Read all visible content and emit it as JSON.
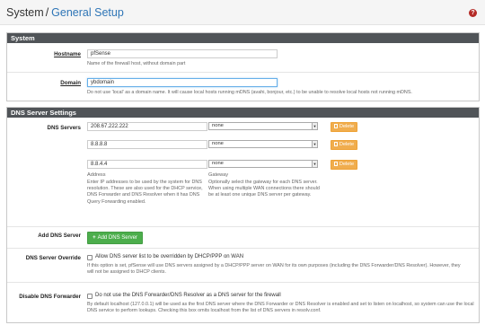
{
  "header": {
    "system": "System",
    "separator": "/",
    "current": "General Setup",
    "help": "?"
  },
  "system_panel": {
    "title": "System",
    "hostname": {
      "label": "Hostname",
      "value": "pfSense",
      "help": "Name of the firewall host, without domain part"
    },
    "domain": {
      "label": "Domain",
      "value": "ybdomain",
      "help": "Do not use 'local' as a domain name. It will cause local hosts running mDNS (avahi, bonjour, etc.) to be unable to resolve local hosts not running mDNS."
    }
  },
  "dns_panel": {
    "title": "DNS Server Settings",
    "servers_label": "DNS Servers",
    "servers": [
      {
        "address": "208.67.222.222",
        "gateway": "none",
        "delete": "Delete"
      },
      {
        "address": "8.8.8.8",
        "gateway": "none",
        "delete": "Delete"
      },
      {
        "address": "8.8.4.4",
        "gateway": "none",
        "delete": "Delete"
      }
    ],
    "address_sub": "Address",
    "address_help": "Enter IP addresses to be used by the system for DNS resolution. These are also used for the DHCP service, DNS Forwarder and DNS Resolver when it has DNS Query Forwarding enabled.",
    "gateway_sub": "Gateway",
    "gateway_help": "Optionally select the gateway for each DNS server. When using multiple WAN connections there should be at least one unique DNS server per gateway.",
    "add_label": "Add DNS Server",
    "add_button": "Add DNS Server",
    "override": {
      "label": "DNS Server Override",
      "check": "Allow DNS server list to be overridden by DHCP/PPP on WAN",
      "help": "If this option is set, pfSense will use DNS servers assigned by a DHCP/PPP server on WAN for its own purposes (including the DNS Forwarder/DNS Resolver). However, they will not be assigned to DHCP clients."
    },
    "disable": {
      "label": "Disable DNS Forwarder",
      "check": "Do not use the DNS Forwarder/DNS Resolver as a DNS server for the firewall",
      "help": "By default localhost (127.0.0.1) will be used as the first DNS server where the DNS Forwarder or DNS Resolver is enabled and set to listen on localhost, so system can use the local DNS service to perform lookups. Checking this box omits localhost from the list of DNS servers in resolv.conf."
    }
  },
  "colors": {
    "heading": "#505458",
    "link": "#2e75b6",
    "delete": "#f0ad4e",
    "add": "#4cae4c"
  }
}
